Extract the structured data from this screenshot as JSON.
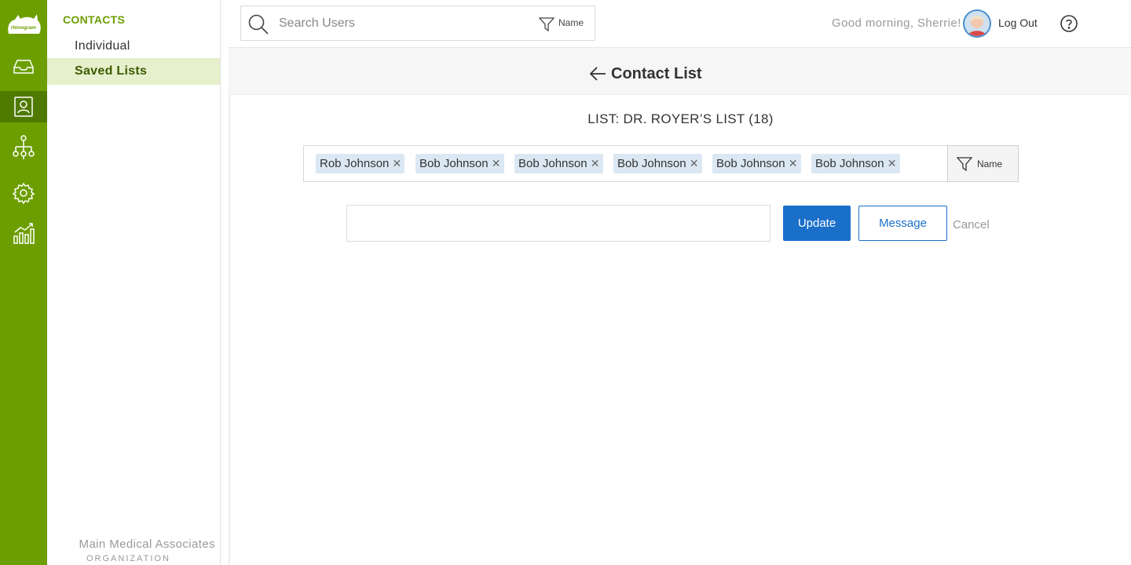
{
  "brand": {
    "logo_text": "rhinogram",
    "accent": "#6c9e00",
    "accent_dark": "#4f7a00",
    "active_bg": "#e6f0cc",
    "primary_button": "#1a6fc9",
    "tag_bg": "#dbe8f4"
  },
  "rail": {
    "items": [
      {
        "icon": "inbox-icon"
      },
      {
        "icon": "contacts-icon",
        "active": true
      },
      {
        "icon": "org-chart-icon"
      },
      {
        "icon": "settings-gear-icon"
      },
      {
        "icon": "analytics-icon"
      }
    ]
  },
  "sidebar": {
    "section_title": "CONTACTS",
    "items": [
      {
        "label": "Individual"
      },
      {
        "label": "Saved Lists",
        "active": true
      }
    ],
    "org_name": "Main Medical Associates",
    "org_label": "ORGANIZATION"
  },
  "header": {
    "search_placeholder": "Search Users",
    "search_filter_label": "Name",
    "greeting": "Good morning, Sherrie!",
    "logout_label": "Log Out"
  },
  "page": {
    "title": "Contact List",
    "list_title": "LIST:  DR. ROYER’S LIST (18)",
    "tags": [
      "Rob Johnson",
      "Bob Johnson",
      "Bob Johnson",
      "Bob Johnson",
      "Bob Johnson",
      "Bob Johnson"
    ],
    "tags_filter_label": "Name",
    "name_input_value": "",
    "update_label": "Update",
    "message_label": "Message",
    "cancel_label": "Cancel"
  }
}
